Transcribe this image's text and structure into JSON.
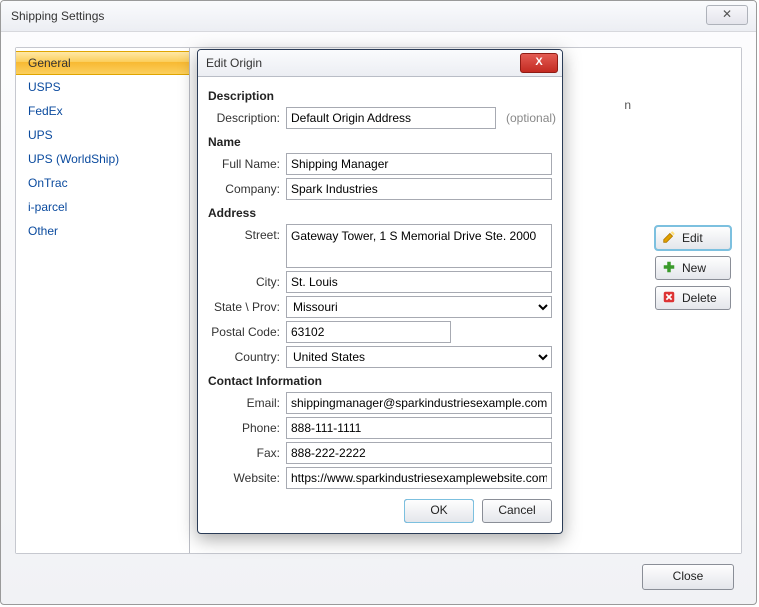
{
  "window": {
    "title": "Shipping Settings",
    "close_label": "Close"
  },
  "sidebar": {
    "items": [
      {
        "label": "General",
        "active": true
      },
      {
        "label": "USPS"
      },
      {
        "label": "FedEx"
      },
      {
        "label": "UPS"
      },
      {
        "label": "UPS (WorldShip)"
      },
      {
        "label": "OnTrac"
      },
      {
        "label": "i-parcel"
      },
      {
        "label": "Other"
      }
    ]
  },
  "toolbar": {
    "edit_label": "Edit",
    "new_label": "New",
    "delete_label": "Delete"
  },
  "bg_text": "n",
  "modal": {
    "title": "Edit Origin",
    "sections": {
      "description_title": "Description",
      "description_label": "Description:",
      "description_value": "Default Origin Address",
      "optional_text": "(optional)",
      "name_title": "Name",
      "fullname_label": "Full Name:",
      "fullname_value": "Shipping Manager",
      "company_label": "Company:",
      "company_value": "Spark Industries",
      "address_title": "Address",
      "street_label": "Street:",
      "street_value": "Gateway Tower, 1 S Memorial Drive Ste. 2000",
      "city_label": "City:",
      "city_value": "St. Louis",
      "state_label": "State \\ Prov:",
      "state_value": "Missouri",
      "postal_label": "Postal Code:",
      "postal_value": "63102",
      "country_label": "Country:",
      "country_value": "United States",
      "contact_title": "Contact Information",
      "email_label": "Email:",
      "email_value": "shippingmanager@sparkindustriesexample.com",
      "phone_label": "Phone:",
      "phone_value": "888-111-1111",
      "fax_label": "Fax:",
      "fax_value": "888-222-2222",
      "website_label": "Website:",
      "website_value": "https://www.sparkindustriesexamplewebsite.com"
    },
    "ok_label": "OK",
    "cancel_label": "Cancel"
  }
}
